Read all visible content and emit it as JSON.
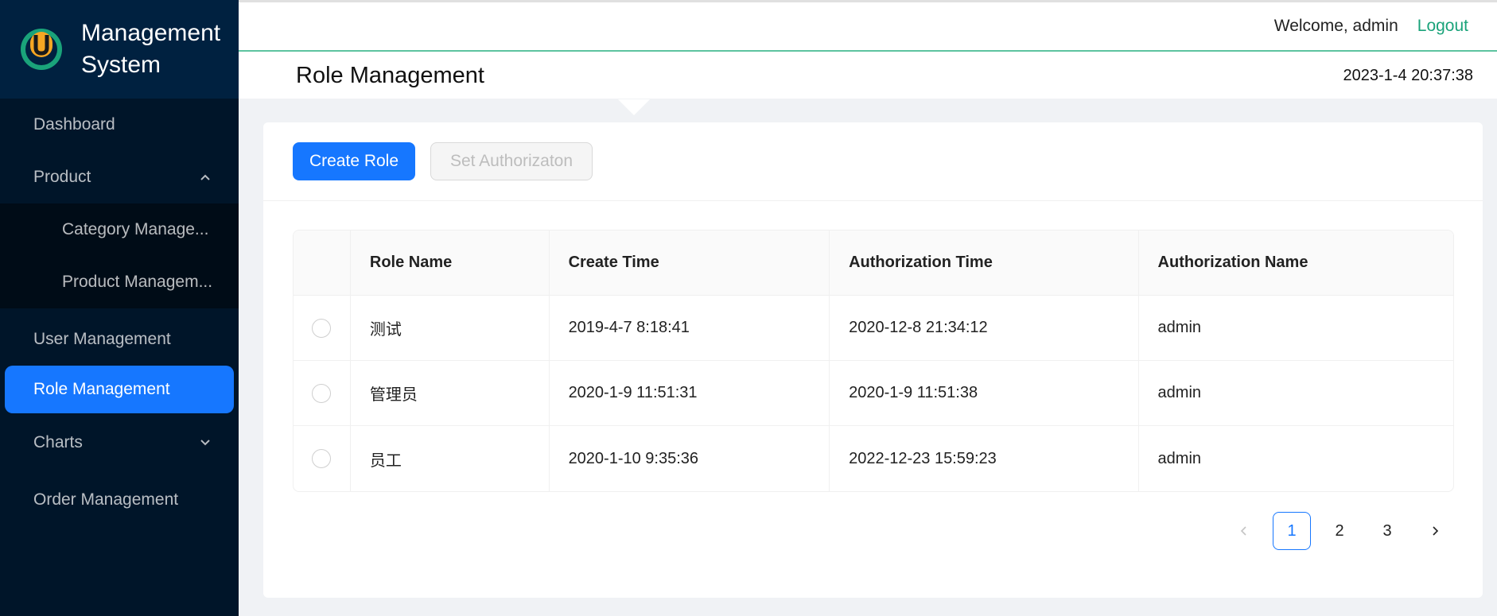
{
  "app": {
    "title": "Management System"
  },
  "header": {
    "welcome": "Welcome, admin",
    "logout": "Logout",
    "page_title": "Role Management",
    "datetime": "2023-1-4 20:37:38"
  },
  "sidebar": {
    "items": [
      {
        "label": "Dashboard"
      },
      {
        "label": "Product",
        "expanded": true,
        "children": [
          {
            "label": "Category Manage..."
          },
          {
            "label": "Product Managem..."
          }
        ]
      },
      {
        "label": "User Management"
      },
      {
        "label": "Role Management",
        "active": true
      },
      {
        "label": "Charts",
        "expanded": false
      },
      {
        "label": "Order Management"
      }
    ]
  },
  "toolbar": {
    "create_label": "Create Role",
    "authorize_label": "Set Authorizaton"
  },
  "table": {
    "columns": [
      "Role Name",
      "Create Time",
      "Authorization Time",
      "Authorization Name"
    ],
    "rows": [
      {
        "name": "测试",
        "create_time": "2019-4-7 8:18:41",
        "auth_time": "2020-12-8 21:34:12",
        "auth_name": "admin"
      },
      {
        "name": "管理员",
        "create_time": "2020-1-9 11:51:31",
        "auth_time": "2020-1-9 11:51:38",
        "auth_name": "admin"
      },
      {
        "name": "员工",
        "create_time": "2020-1-10 9:35:36",
        "auth_time": "2022-12-23 15:59:23",
        "auth_name": "admin"
      }
    ]
  },
  "pagination": {
    "pages": [
      "1",
      "2",
      "3"
    ],
    "current": "1"
  },
  "colors": {
    "sidebar_bg": "#001529",
    "primary": "#1677ff",
    "logout": "#1aa37a",
    "header_line": "#5dc3a0"
  },
  "icons": {
    "logo": "u-logo-icon",
    "expand": "chevron-up-icon",
    "collapse": "chevron-down-icon",
    "prev": "chevron-left-icon",
    "next": "chevron-right-icon"
  }
}
